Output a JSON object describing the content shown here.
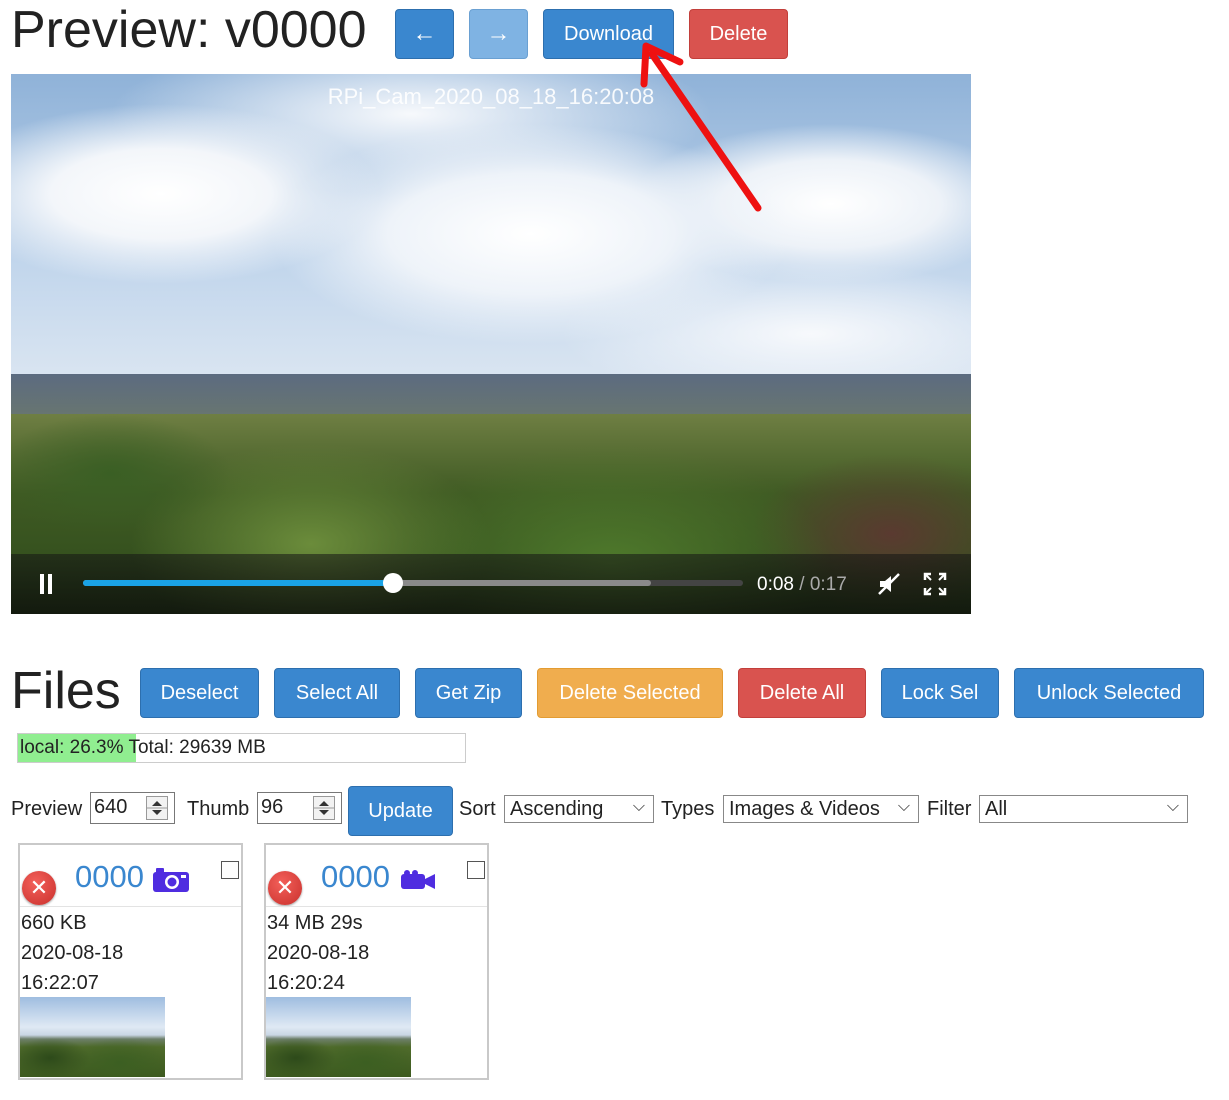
{
  "preview": {
    "title": "Preview: v0000",
    "prev_label": "←",
    "next_label": "→",
    "download_label": "Download",
    "delete_label": "Delete"
  },
  "video": {
    "overlay_text": "RPi_Cam_2020_08_18_16:20:08",
    "current_time": "0:08",
    "separator": " / ",
    "duration": "0:17",
    "played_fraction": 0.47,
    "buffered_fraction": 0.86,
    "icons": [
      "pause-icon",
      "mute-icon",
      "fullscreen-icon"
    ]
  },
  "files": {
    "title": "Files",
    "buttons": {
      "deselect": "Deselect",
      "select_all": "Select All",
      "get_zip": "Get Zip",
      "delete_selected": "Delete Selected",
      "delete_all": "Delete All",
      "lock_sel": "Lock Sel",
      "unlock_selected": "Unlock Selected"
    },
    "storage": {
      "local": "local: 26.3%",
      "total": "Total: 29639 MB",
      "local_fraction": 0.263
    }
  },
  "controls": {
    "preview_label": "Preview",
    "preview_value": "640",
    "thumb_label": "Thumb",
    "thumb_value": "96",
    "update_label": "Update",
    "sort_label": "Sort",
    "sort_value": "Ascending",
    "types_label": "Types",
    "types_value": "Images & Videos",
    "filter_label": "Filter",
    "filter_value": "All"
  },
  "cards": [
    {
      "number": "0000",
      "type_icon": "camera-icon",
      "size": "660 KB",
      "date": "2020-08-18",
      "time": "16:22:07"
    },
    {
      "number": "0000",
      "type_icon": "video-camera-icon",
      "size": "34 MB 29s",
      "date": "2020-08-18",
      "time": "16:20:24"
    }
  ],
  "colors": {
    "primary": "#3a87cf",
    "danger": "#d9534f",
    "warning": "#f0ad4e",
    "storage_fill": "#90ee90",
    "progress": "#1aa3e6",
    "media_icon": "#4f2de0",
    "annotation_arrow": "#ee1111"
  }
}
